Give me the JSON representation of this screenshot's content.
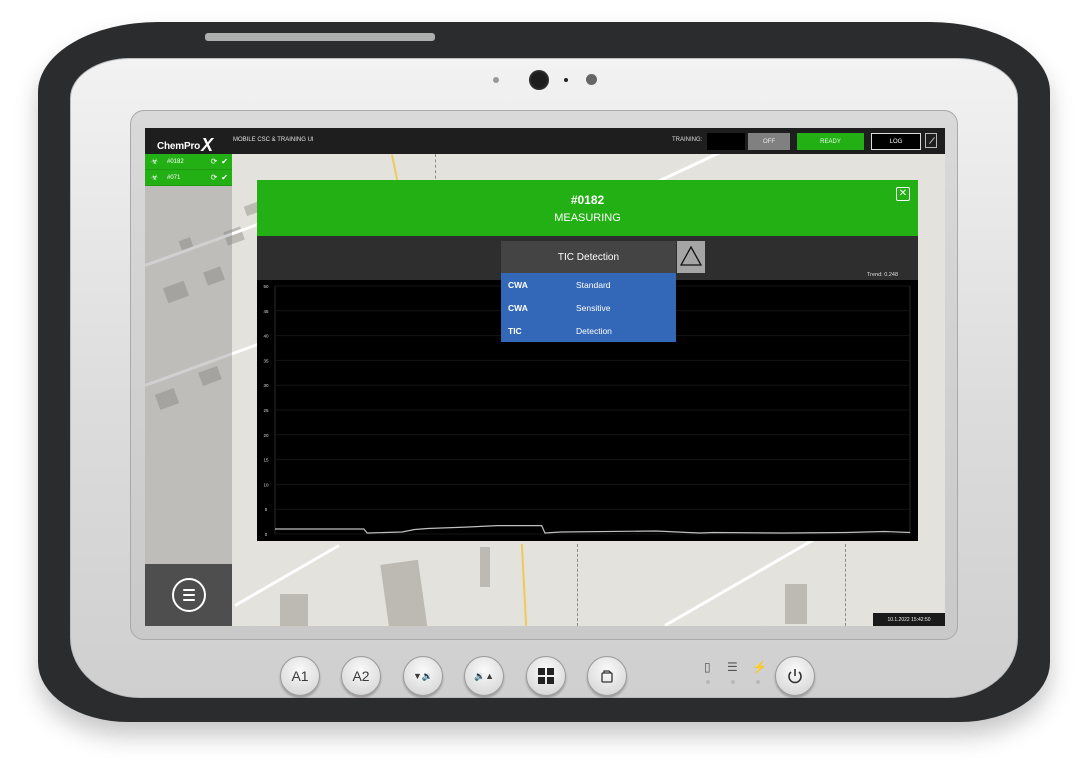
{
  "app": {
    "logo_text": "ChemPro",
    "logo_mark": "X",
    "title": "MOBILE CSC & TRAINING UI"
  },
  "topbar": {
    "training_label": "TRAINING:",
    "training_value": "",
    "off_label": "OFF",
    "ready_label": "READY",
    "log_label": "LOG",
    "expand_icon": "expand-icon"
  },
  "sidebar": {
    "units": [
      {
        "id": "#0182",
        "icon": "radiation-icon",
        "status_icons": [
          "link-icon",
          "check-icon"
        ]
      },
      {
        "id": "#071",
        "icon": "radiation-icon",
        "status_icons": [
          "link-icon",
          "check-icon"
        ]
      }
    ],
    "menu_icon": "hamburger-menu-icon"
  },
  "modal": {
    "unit_id": "#0182",
    "status": "MEASURING",
    "close_icon": "close-icon",
    "mode_selected": "TIC Detection",
    "alarm_icon": "warning-triangle-icon",
    "trend_text": "Trend: 0.248",
    "mode_options": [
      {
        "type": "CWA",
        "mode": "Standard"
      },
      {
        "type": "CWA",
        "mode": "Sensitive"
      },
      {
        "type": "TIC",
        "mode": "Detection"
      }
    ]
  },
  "chart_data": {
    "type": "line",
    "title": "",
    "xlabel": "",
    "ylabel": "",
    "ylim": [
      0,
      50
    ],
    "yticks": [
      0,
      5,
      10,
      15,
      20,
      25,
      30,
      35,
      40,
      45,
      50
    ],
    "grid": true,
    "series": [
      {
        "name": "Trend",
        "color": "#bfbfbf",
        "x": [
          0,
          0.14,
          0.145,
          0.2,
          0.22,
          0.24,
          0.3,
          0.35,
          0.42,
          0.425,
          0.45,
          0.6,
          0.65,
          0.67,
          0.69,
          0.8,
          0.9,
          0.96,
          1.0
        ],
        "values": [
          1.0,
          1.0,
          0.2,
          0.4,
          0.9,
          1.1,
          1.4,
          1.7,
          1.7,
          0.2,
          0.4,
          0.6,
          0.3,
          0.2,
          0.3,
          0.2,
          0.3,
          0.5,
          0.3
        ]
      }
    ]
  },
  "footer": {
    "timestamp": "10.1.2022 15:42:50"
  },
  "hardware": {
    "buttons": [
      "A1",
      "A2",
      "vol-down",
      "vol-up",
      "windows",
      "rotate-lock",
      "power"
    ],
    "labels": {
      "a1": "A1",
      "a2": "A2"
    },
    "indicators": [
      "battery-icon",
      "storage-icon",
      "power-status-icon"
    ]
  }
}
